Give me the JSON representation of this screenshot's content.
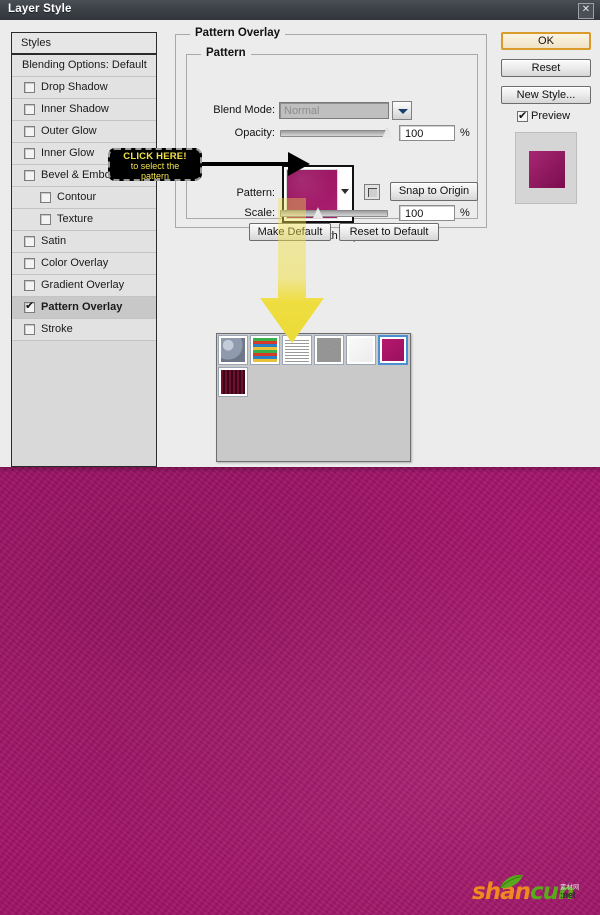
{
  "window": {
    "title": "Layer Style",
    "close_label": "✕"
  },
  "styles_panel": {
    "header": "Styles",
    "blending_options": "Blending Options: Default",
    "items": [
      {
        "label": "Drop Shadow",
        "checked": false,
        "indent": 0,
        "selected": false
      },
      {
        "label": "Inner Shadow",
        "checked": false,
        "indent": 0,
        "selected": false
      },
      {
        "label": "Outer Glow",
        "checked": false,
        "indent": 0,
        "selected": false
      },
      {
        "label": "Inner Glow",
        "checked": false,
        "indent": 0,
        "selected": false
      },
      {
        "label": "Bevel & Emboss",
        "checked": false,
        "indent": 0,
        "selected": false
      },
      {
        "label": "Contour",
        "checked": false,
        "indent": 1,
        "selected": false
      },
      {
        "label": "Texture",
        "checked": false,
        "indent": 1,
        "selected": false
      },
      {
        "label": "Satin",
        "checked": false,
        "indent": 0,
        "selected": false
      },
      {
        "label": "Color Overlay",
        "checked": false,
        "indent": 0,
        "selected": false
      },
      {
        "label": "Gradient Overlay",
        "checked": false,
        "indent": 0,
        "selected": false
      },
      {
        "label": "Pattern Overlay",
        "checked": true,
        "indent": 0,
        "selected": true
      },
      {
        "label": "Stroke",
        "checked": false,
        "indent": 0,
        "selected": false
      }
    ]
  },
  "pattern_overlay": {
    "group_title": "Pattern Overlay",
    "section_title": "Pattern",
    "blend_mode": {
      "label": "Blend Mode:",
      "value": "Normal"
    },
    "opacity": {
      "label": "Opacity:",
      "value": "100",
      "unit": "%"
    },
    "pattern": {
      "label": "Pattern:",
      "swatch_color": "#a81369"
    },
    "snap_to_origin_label": "Snap to Origin",
    "scale": {
      "label": "Scale:",
      "value": "100",
      "unit": "%"
    },
    "link_with_layer": {
      "label": "Link with Layer",
      "checked": true
    },
    "make_default_label": "Make Default",
    "reset_to_default_label": "Reset to Default"
  },
  "right_buttons": {
    "ok": "OK",
    "reset": "Reset",
    "new_style": "New Style...",
    "preview_label": "Preview",
    "preview_checked": true,
    "preview_swatch_color": "#9d0f63"
  },
  "pattern_picker": {
    "selected_index": 5,
    "swatches": [
      {
        "name": "bubbles-pattern",
        "color": "#8f9aad"
      },
      {
        "name": "rainbow-pattern",
        "color": "#e8c13a"
      },
      {
        "name": "fine-lines-pattern",
        "color": "#d8d8d8"
      },
      {
        "name": "gray-noise-pattern",
        "color": "#9a9a9a"
      },
      {
        "name": "white-paper-pattern",
        "color": "#f2f2f2"
      },
      {
        "name": "magenta-pattern",
        "color": "#a81369"
      },
      {
        "name": "dark-red-stripes-pattern",
        "color": "#6d1030"
      }
    ]
  },
  "callout": {
    "line1": "CLICK HERE!",
    "line2": "to select the",
    "line3": "pattern",
    "text_color": "#f2e14a",
    "background": "#000000"
  },
  "annotations": {
    "arrow_color": "#f0e04a"
  },
  "background": {
    "color": "#a5156a"
  },
  "watermark": {
    "text_part_a": "shan",
    "text_part_b": "cun",
    "domain": ":net",
    "top_text": "素材网"
  }
}
